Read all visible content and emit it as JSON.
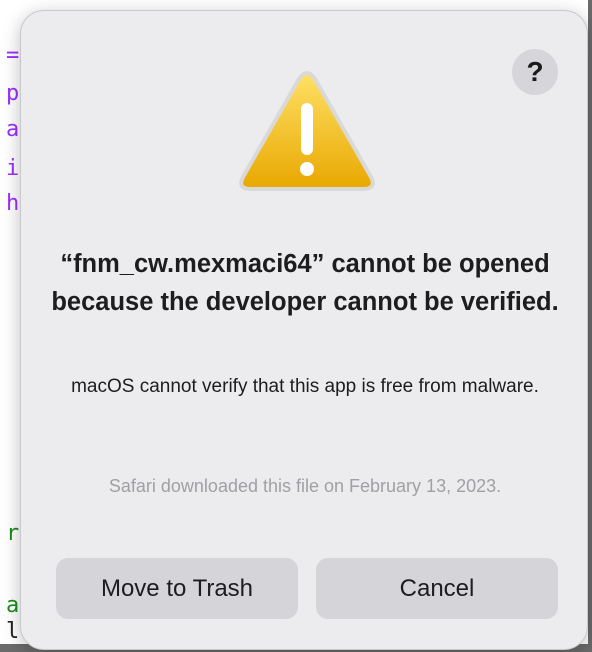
{
  "dialog": {
    "help_label": "?",
    "title": "“fnm_cw.mexmaci64” cannot be opened because the developer cannot be verified.",
    "message": "macOS cannot verify that this app is free from malware.",
    "source_note": "Safari downloaded this file on February 13, 2023.",
    "icon": "warning-triangle-icon",
    "buttons": {
      "move_to_trash": "Move to Trash",
      "cancel": "Cancel"
    }
  },
  "background_code": {
    "fragments": [
      "=",
      "p",
      "a",
      "i",
      "h",
      "r",
      "a",
      "l"
    ]
  },
  "colors": {
    "dialog_bg": "#ececef",
    "button_bg": "#d5d5d9",
    "warning_yellow": "#f5c518",
    "secondary_text": "#a0a0a4",
    "code_purple": "#9b30ff",
    "code_green": "#1e8c1e"
  }
}
